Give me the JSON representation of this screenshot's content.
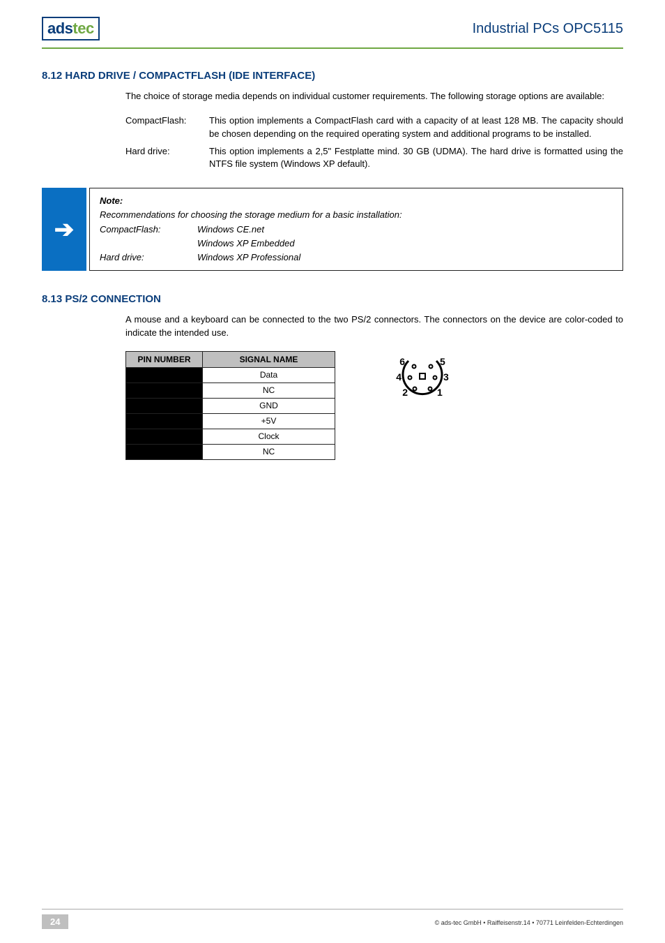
{
  "header": {
    "logo_ads": "ads",
    "logo_tec": "tec",
    "title": "Industrial PCs OPC5115"
  },
  "s812": {
    "heading": "8.12 HARD DRIVE / COMPACTFLASH (IDE INTERFACE)",
    "intro": "The choice of storage media depends on individual customer requirements. The following storage options are available:",
    "cf_term": "CompactFlash:",
    "cf_desc": "This option implements a CompactFlash card with a capacity of at least 128 MB. The capacity should be chosen depending on the required operating system and additional programs to be installed.",
    "hd_term": "Hard drive:",
    "hd_desc": "This option implements a 2,5\" Festplatte mind. 30 GB (UDMA). The hard drive is formatted using the NTFS file system (Windows XP default)."
  },
  "note": {
    "arrow": "➔",
    "title": "Note:",
    "line1": "Recommendations for choosing the storage medium for a basic installation:",
    "cf_key": "CompactFlash:",
    "cf_val1": "Windows CE.net",
    "cf_val2": "Windows XP Embedded",
    "hd_key": "Hard drive:",
    "hd_val": "Windows XP Professional"
  },
  "s813": {
    "heading": "8.13 PS/2 CONNECTION",
    "intro": "A mouse and a keyboard can be connected to the two PS/2 connectors. The connectors on the device are color-coded to indicate the intended use.",
    "col1": "PIN NUMBER",
    "col2": "SIGNAL NAME",
    "rows": {
      "0": "Data",
      "1": "NC",
      "2": "GND",
      "3": "+5V",
      "4": "Clock",
      "5": "NC"
    }
  },
  "footer": {
    "page": "24",
    "copy": "© ads-tec GmbH • Raiffeisenstr.14 • 70771 Leinfelden-Echterdingen"
  }
}
